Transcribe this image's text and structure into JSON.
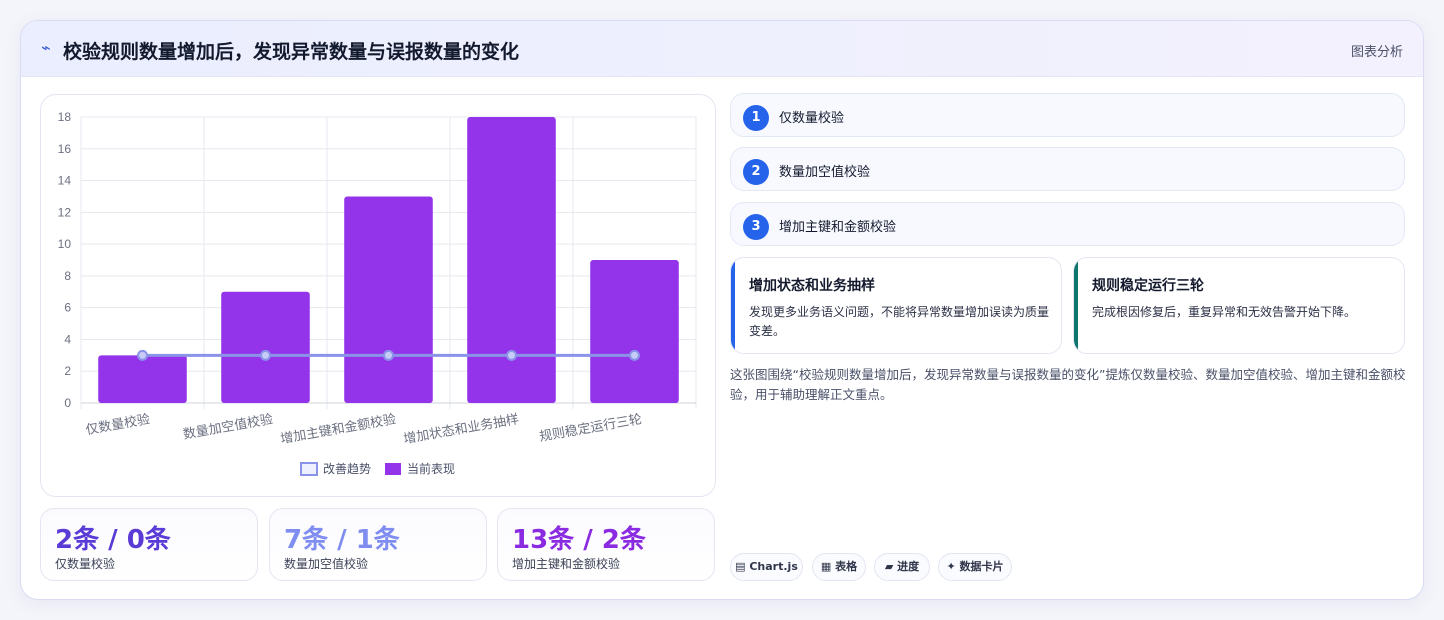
{
  "header": {
    "icon": "trend-icon",
    "title": "校验规则数量增加后，发现异常数量与误报数量的变化",
    "action_label": "图表分析"
  },
  "chart_data": {
    "type": "bar",
    "categories": [
      "仅数量校验",
      "数量加空值校验",
      "增加主键和金额校验",
      "增加状态和业务抽样",
      "规则稳定运行三轮"
    ],
    "series": [
      {
        "name": "改善趋势",
        "type": "line",
        "values": [
          3,
          3,
          3,
          3,
          3
        ],
        "color": "#8a93e8"
      },
      {
        "name": "当前表现",
        "type": "bar",
        "values": [
          3,
          7,
          13,
          18,
          9
        ],
        "color": "#9333ea"
      }
    ],
    "ylim": [
      0,
      18
    ],
    "yticks": [
      0,
      2,
      4,
      6,
      8,
      10,
      12,
      14,
      16,
      18
    ],
    "grid": true,
    "legend_position": "bottom"
  },
  "stats": [
    {
      "value": "2条 / 0条",
      "label": "仅数量校验",
      "color": "#5b3bd6"
    },
    {
      "value": "7条 / 1条",
      "label": "数量加空值校验",
      "color": "#7f8df0"
    },
    {
      "value": "13条 / 2条",
      "label": "增加主键和金额校验",
      "color": "#8a2be2"
    }
  ],
  "steps": [
    {
      "num": "1",
      "label": "仅数量校验"
    },
    {
      "num": "2",
      "label": "数量加空值校验"
    },
    {
      "num": "3",
      "label": "增加主键和金额校验"
    }
  ],
  "notes": [
    {
      "title": "增加状态和业务抽样",
      "text": "发现更多业务语义问题，不能将异常数量增加误读为质量变差。",
      "color": "#2563eb"
    },
    {
      "title": "规则稳定运行三轮",
      "text": "完成根因修复后，重复异常和无效告警开始下降。",
      "color": "#0f766e"
    }
  ],
  "summary": "这张图围绕“校验规则数量增加后，发现异常数量与误报数量的变化”提炼仅数量校验、数量加空值校验、增加主键和金额校验，用于辅助理解正文重点。",
  "tags": [
    {
      "icon": "▤",
      "label": "Chart.js"
    },
    {
      "icon": "▦",
      "label": "表格"
    },
    {
      "icon": "▰",
      "label": "进度"
    },
    {
      "icon": "✦",
      "label": "数据卡片"
    }
  ]
}
